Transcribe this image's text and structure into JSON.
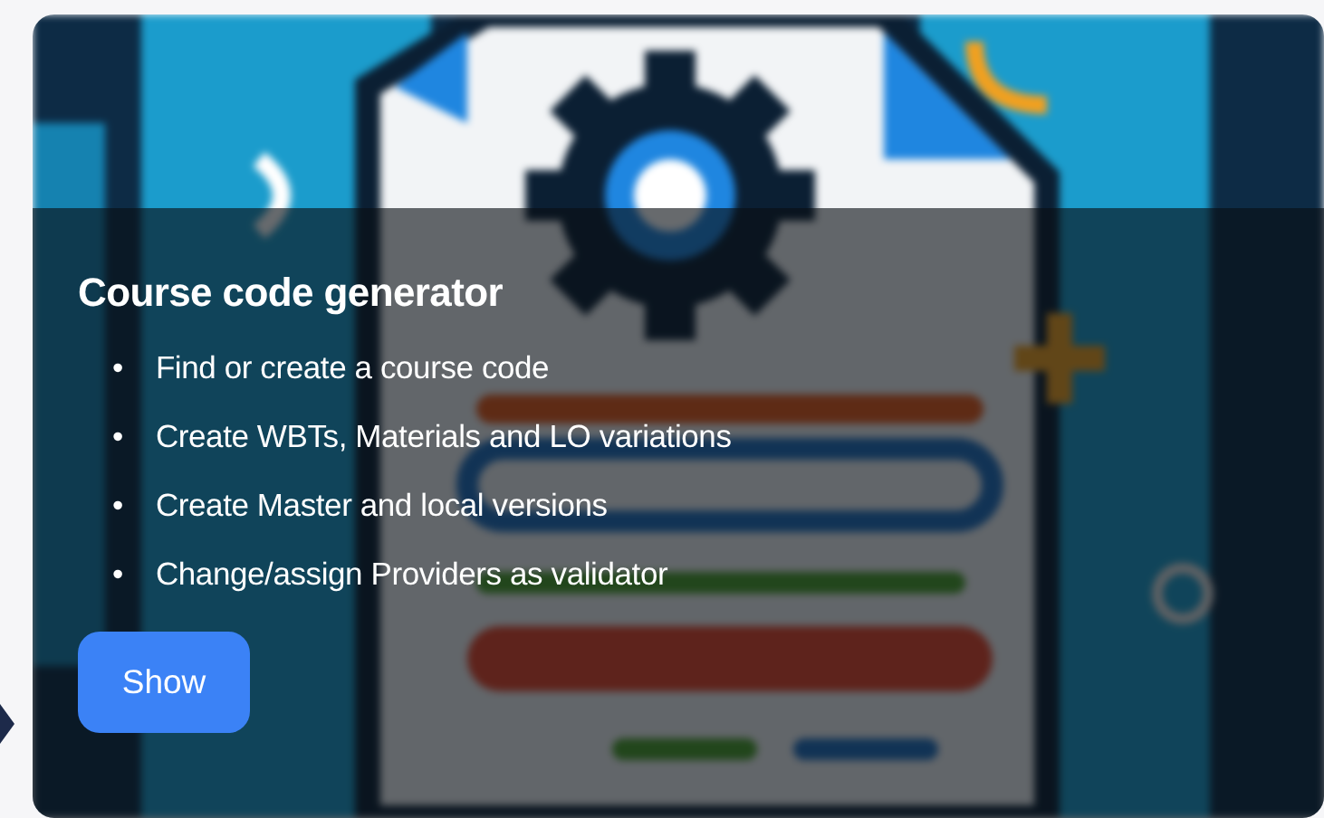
{
  "card": {
    "title": "Course code generator",
    "bullets": [
      {
        "marker": "•",
        "text": "Find or create a course code"
      },
      {
        "marker": "•",
        "text": "Create WBTs, Materials and LO variations"
      },
      {
        "marker": "•",
        "text": "Create Master and local versions"
      },
      {
        "marker": "•",
        "text": "Change/assign Providers as validator"
      }
    ],
    "button": "Show"
  }
}
